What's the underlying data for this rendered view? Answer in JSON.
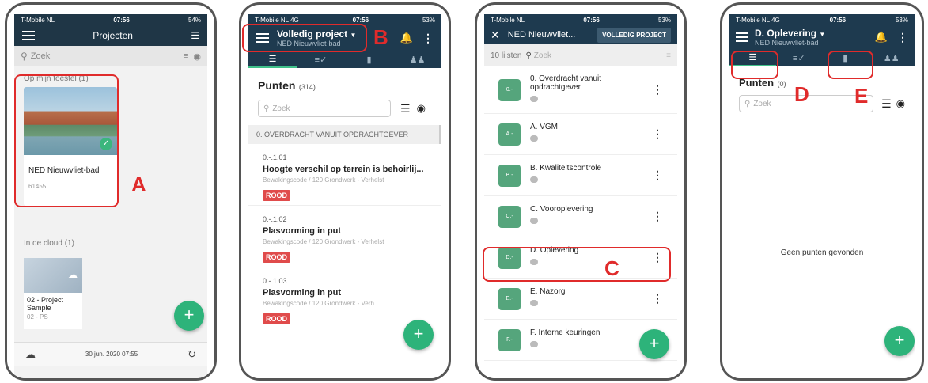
{
  "phone1": {
    "status": {
      "carrier": "T-Mobile NL",
      "time": "07:56",
      "battery": "54%"
    },
    "title": "Projecten",
    "search_placeholder": "Zoek",
    "section_device": "Op mijn toestel (1)",
    "project_device": {
      "name": "NED Nieuwvliet-bad",
      "id": "61455"
    },
    "section_cloud": "In de cloud (1)",
    "project_cloud": {
      "name": "02 - Project Sample",
      "code": "02 - PS"
    },
    "footer_date": "30 jun. 2020 07:55",
    "annotation": "A"
  },
  "phone2": {
    "status": {
      "carrier": "T-Mobile NL",
      "network": "4G",
      "time": "07:56",
      "battery": "53%"
    },
    "title": "Volledig project",
    "subtitle": "NED Nieuwvliet-bad",
    "annotation": "B",
    "section_title": "Punten",
    "section_count": "(314)",
    "search_placeholder": "Zoek",
    "group_header": "0. OVERDRACHT VANUIT OPDRACHTGEVER",
    "items": [
      {
        "code": "0.-.1.01",
        "title": "Hoogte verschil op terrein is behoirlij...",
        "meta": "Bewakingscode / 120 Grondwerk - Verhelst",
        "status": "ROOD"
      },
      {
        "code": "0.-.1.02",
        "title": "Plasvorming in put",
        "meta": "Bewakingscode / 120 Grondwerk - Verhelst",
        "status": "ROOD"
      },
      {
        "code": "0.-.1.03",
        "title": "Plasvorming in put",
        "meta": "Bewakingscode / 120 Grondwerk - Verh",
        "status": "ROOD"
      }
    ]
  },
  "phone3": {
    "status": {
      "carrier": "T-Mobile NL",
      "time": "07:56",
      "battery": "53%"
    },
    "title": "NED Nieuwvliet...",
    "button": "VOLLEDIG PROJECT",
    "list_count": "10 lijsten",
    "search_placeholder": "Zoek",
    "annotation": "C",
    "lists": [
      {
        "abbr": "0.-",
        "name": "0. Overdracht vanuit opdrachtgever"
      },
      {
        "abbr": "A.-",
        "name": "A. VGM"
      },
      {
        "abbr": "B.-",
        "name": "B. Kwaliteitscontrole"
      },
      {
        "abbr": "C.-",
        "name": "C. Vooroplevering"
      },
      {
        "abbr": "D.-",
        "name": "D. Oplevering"
      },
      {
        "abbr": "E.-",
        "name": "E. Nazorg"
      },
      {
        "abbr": "F.-",
        "name": "F. Interne keuringen"
      }
    ]
  },
  "phone4": {
    "status": {
      "carrier": "T-Mobile NL",
      "network": "4G",
      "time": "07:56",
      "battery": "53%"
    },
    "title": "D. Oplevering",
    "subtitle": "NED Nieuwvliet-bad",
    "section_title": "Punten",
    "section_count": "(0)",
    "annotation_d": "D",
    "annotation_e": "E",
    "search_placeholder": "Zoek",
    "empty_message": "Geen punten gevonden"
  },
  "colors": {
    "header": "#1f3646",
    "accent": "#2db37a",
    "annotation": "#e02b2b",
    "rood": "#e04b4b",
    "list_icon": "#55a57c"
  }
}
